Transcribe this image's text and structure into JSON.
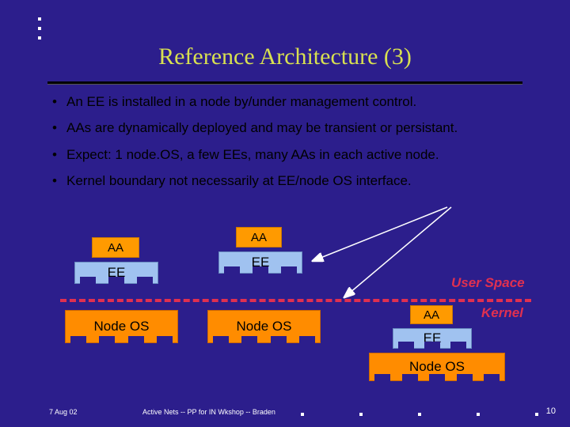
{
  "title": "Reference Architecture (3)",
  "bullets": [
    "An EE is installed in a node by/under management control.",
    "AAs are dynamically deployed and may be transient or persistant.",
    "Expect: 1 node.OS, a few EEs, many AAs in each active node.",
    "Kernel boundary not necessarily at EE/node OS interface."
  ],
  "labels": {
    "aa": "AA",
    "ee": "EE",
    "nodeos": "Node OS",
    "user_space": "User Space",
    "kernel": "Kernel"
  },
  "footer": {
    "date": "7 Aug 02",
    "center": "Active Nets -- PP for IN Wkshop -- Braden",
    "page": "10"
  }
}
